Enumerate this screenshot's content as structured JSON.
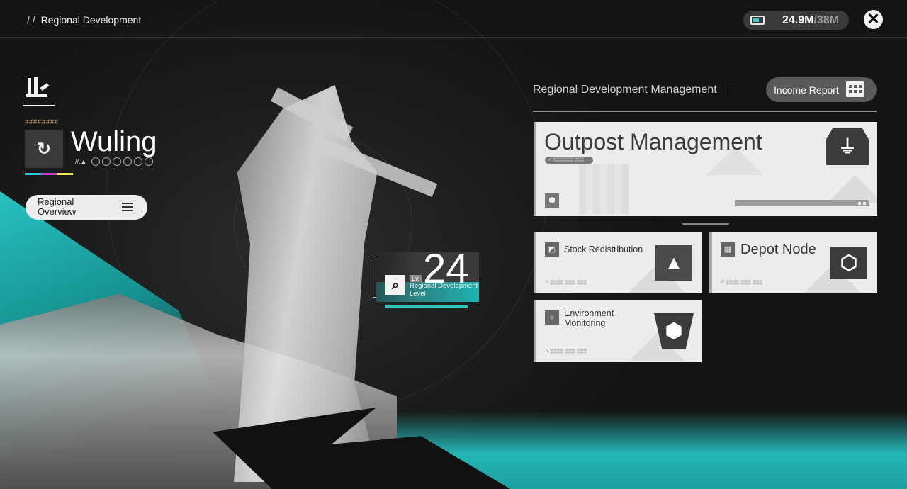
{
  "header": {
    "breadcrumb_prefix": "/ /",
    "breadcrumb_title": "Regional Development",
    "currency_value": "24.9M",
    "currency_max": "/38M",
    "close_symbol": "✕"
  },
  "region": {
    "dashes": "########",
    "icon_glyph": "↻",
    "name": "Wuling",
    "tag": "//.▲",
    "dot_count": 6,
    "colors": [
      "#27c7d1",
      "#c43fd1",
      "#f0e44a"
    ],
    "overview_label": "Regional Overview"
  },
  "level": {
    "lv_tag": "Lv.",
    "value": "24",
    "label": "Regional Development Level"
  },
  "management": {
    "title": "Regional Development Management",
    "income_label": "Income Report",
    "outpost": {
      "title": "Outpost Management",
      "tag": "// ▒▒▒▒▒▒▒ ▒▒▒"
    },
    "cards": [
      {
        "label": "Stock Redistribution",
        "code": "// ▒▒▒▒ ▒▒▒ ▒▒▒"
      },
      {
        "label": "Depot Node",
        "code": "// ▒▒▒▒ ▒▒▒ ▒▒▒"
      },
      {
        "label": "Environment Monitoring",
        "code": "// ▒▒▒▒ ▒▒▒ ▒▒▒"
      }
    ]
  },
  "colors": {
    "accent_teal": "#27c1c0",
    "card_bg": "#ececec"
  }
}
